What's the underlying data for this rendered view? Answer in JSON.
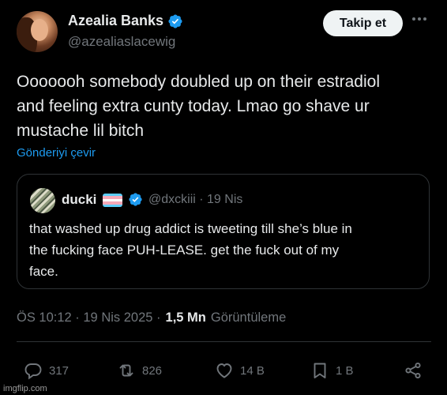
{
  "author": {
    "name": "Azealia Banks",
    "handle": "@azealiaslacewig"
  },
  "header": {
    "follow_label": "Takip et"
  },
  "tweet": {
    "line1": "Ooooooh somebody doubled up on their estradiol",
    "line2": "and feeling extra cunty today. Lmao go shave ur",
    "line3": "mustache lil bitch",
    "translate_label": "Gönderiyi çevir"
  },
  "quote": {
    "name": "ducki",
    "handle_date": "@dxckiii · 19 Nis",
    "line1": "that washed up drug addict is tweeting till she’s blue in",
    "line2": "the fucking face PUH-LEASE. get the fuck out of my",
    "line3": "face."
  },
  "meta": {
    "time_date": "ÖS 10:12 · 19 Nis 2025 ·",
    "views_count": "1,5 Mn",
    "views_label": "Görüntüleme"
  },
  "actions": {
    "replies": "317",
    "reposts": "826",
    "likes": "14 B",
    "bookmarks": "1 B"
  },
  "watermark": "imgflip.com",
  "colors": {
    "background": "#000000",
    "text": "#e7e9ea",
    "muted": "#71767b",
    "link": "#1d9bf0",
    "verified": "#1d9bf0",
    "border": "#2f3336"
  },
  "icons": {
    "more": "more-horizontal-icon",
    "reply": "reply-icon",
    "repost": "repost-icon",
    "like": "heart-icon",
    "bookmark": "bookmark-icon",
    "share": "share-icon"
  }
}
